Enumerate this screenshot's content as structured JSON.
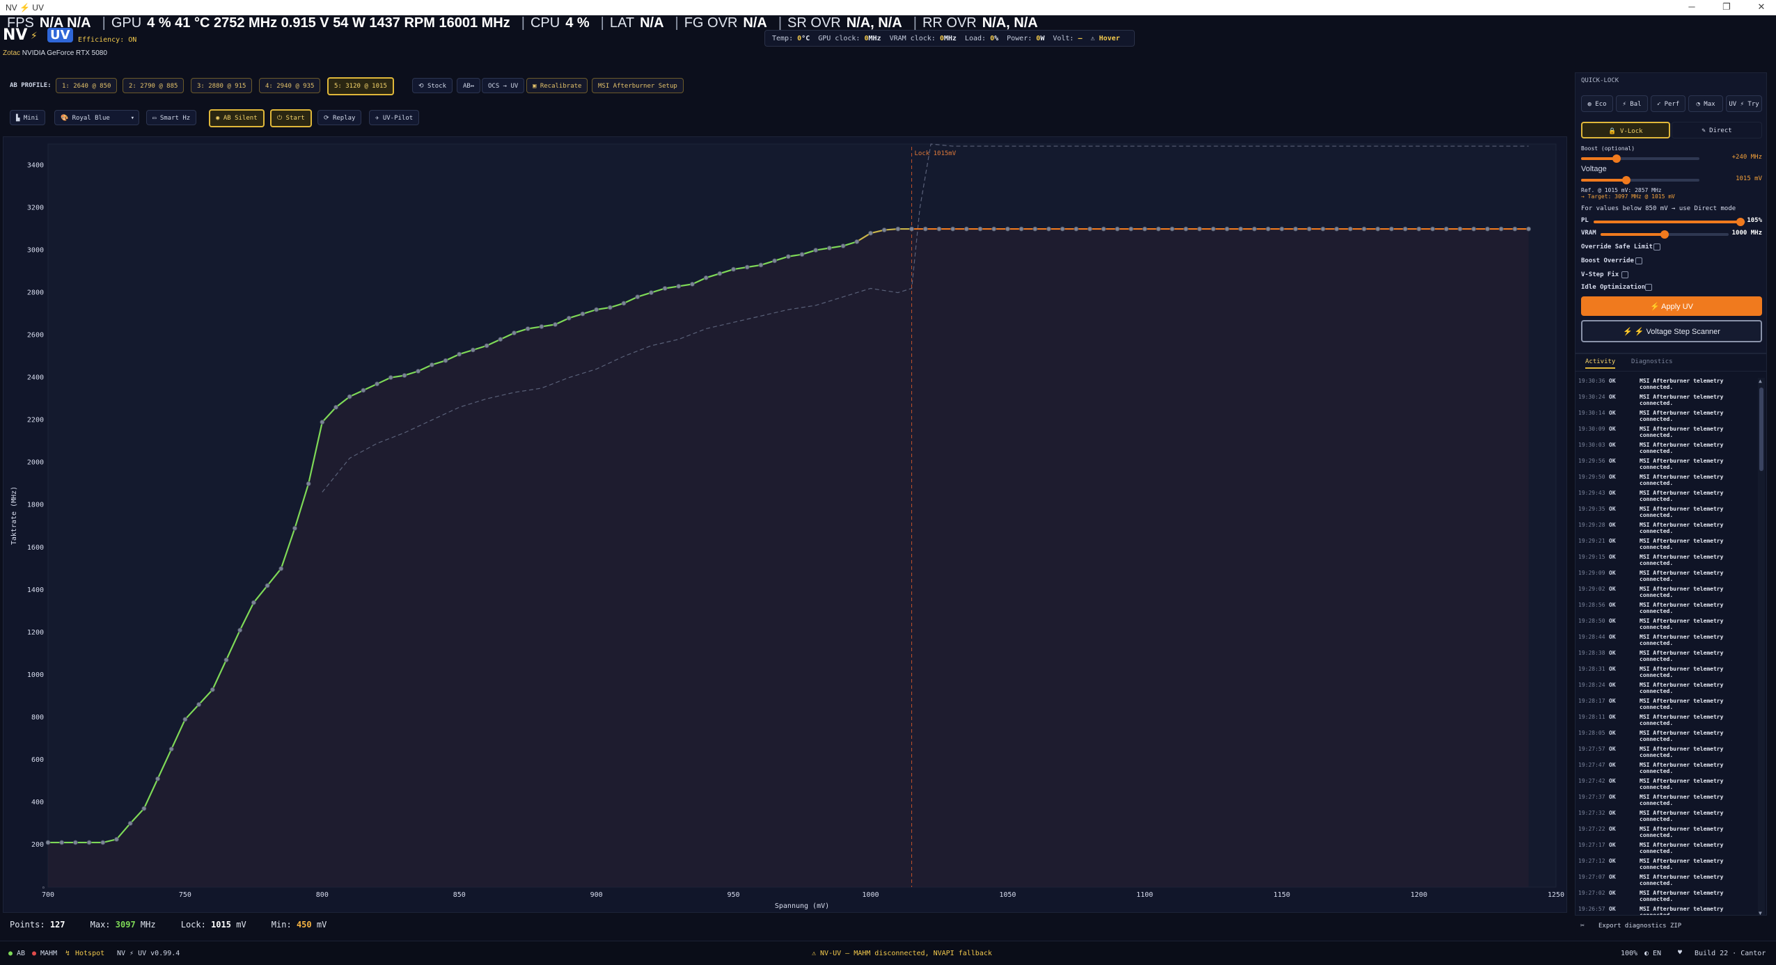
{
  "window": {
    "title": "NV ⚡ UV"
  },
  "osd": [
    {
      "label": "FPS",
      "value": "N/A  N/A"
    },
    {
      "label": "GPU",
      "value": "4 %  41 °C  2752 MHz  0.915 V  54 W  1437 RPM  16001 MHz"
    },
    {
      "label": "CPU",
      "value": "4 %"
    },
    {
      "label": "LAT",
      "value": "N/A"
    },
    {
      "label": "FG OVR",
      "value": "N/A"
    },
    {
      "label": "SR OVR",
      "value": "N/A,  N/A"
    },
    {
      "label": "RR OVR",
      "value": "N/A,  N/A"
    }
  ],
  "logo": {
    "left": "NV",
    "right": "UV"
  },
  "efficiency": "Efficiency: ON",
  "gpu": {
    "brand": "Zotac",
    "model": "NVIDIA GeForce RTX 5080"
  },
  "telemetry": [
    {
      "k": "Temp:",
      "v": "0",
      "u": "°C"
    },
    {
      "k": "GPU clock:",
      "v": "0",
      "u": "MHz"
    },
    {
      "k": "VRAM clock:",
      "v": "0",
      "u": "MHz"
    },
    {
      "k": "Load:",
      "v": "0",
      "u": "%"
    },
    {
      "k": "Power:",
      "v": "0",
      "u": "W"
    },
    {
      "k": "Volt:",
      "v": "—",
      "u": ""
    },
    {
      "k": "⚠",
      "v": "Hover",
      "u": ""
    }
  ],
  "toolbar1": {
    "ab_profile_label": "AB PROFILE:",
    "profiles": [
      "1: 2640 @ 850",
      "2: 2790 @ 885",
      "3: 2880 @ 915",
      "4: 2940 @ 935",
      "5: 3120 @ 1015"
    ],
    "stock": "⟲ Stock",
    "ab": "AB↔",
    "ocs": "OCS → UV",
    "recalibrate": "Recalibrate",
    "msi_setup": "MSI Afterburner Setup"
  },
  "toolbar2": {
    "mini": "Mini",
    "theme": "Royal Blue",
    "smart_hz": "Smart Hz",
    "ab_silent": "AB Silent",
    "start": "Start",
    "replay": "Replay",
    "uv_pilot": "UV-Pilot"
  },
  "chart_data": {
    "type": "line",
    "xlabel": "Spannung (mV)",
    "ylabel": "Taktrate (MHz)",
    "xlim": [
      700,
      1250
    ],
    "ylim": [
      0,
      3500
    ],
    "x_ticks": [
      700,
      750,
      800,
      850,
      900,
      950,
      1000,
      1050,
      1100,
      1150,
      1200,
      1250
    ],
    "y_ticks": [
      200,
      400,
      600,
      800,
      1000,
      1200,
      1400,
      1600,
      1800,
      2000,
      2200,
      2400,
      2600,
      2800,
      3000,
      3200,
      3400
    ],
    "annotation": {
      "text": "Lock 1015mV",
      "x": 1015
    },
    "grid": false,
    "series": [
      {
        "color": "#f07a1e",
        "points": [
          [
            700,
            210
          ],
          [
            705,
            210
          ],
          [
            710,
            210
          ],
          [
            715,
            210
          ],
          [
            720,
            210
          ],
          [
            725,
            225
          ],
          [
            730,
            300
          ],
          [
            735,
            370
          ],
          [
            740,
            510
          ],
          [
            745,
            650
          ],
          [
            750,
            790
          ],
          [
            755,
            860
          ],
          [
            760,
            930
          ],
          [
            765,
            1070
          ],
          [
            770,
            1210
          ],
          [
            775,
            1340
          ],
          [
            780,
            1420
          ],
          [
            785,
            1500
          ],
          [
            790,
            1690
          ],
          [
            795,
            1900
          ],
          [
            800,
            2190
          ],
          [
            805,
            2260
          ],
          [
            810,
            2310
          ],
          [
            815,
            2340
          ],
          [
            820,
            2370
          ],
          [
            825,
            2400
          ],
          [
            830,
            2410
          ],
          [
            835,
            2430
          ],
          [
            840,
            2460
          ],
          [
            845,
            2480
          ],
          [
            850,
            2510
          ],
          [
            855,
            2530
          ],
          [
            860,
            2550
          ],
          [
            865,
            2580
          ],
          [
            870,
            2610
          ],
          [
            875,
            2630
          ],
          [
            880,
            2640
          ],
          [
            885,
            2650
          ],
          [
            890,
            2680
          ],
          [
            895,
            2700
          ],
          [
            900,
            2720
          ],
          [
            905,
            2730
          ],
          [
            910,
            2750
          ],
          [
            915,
            2780
          ],
          [
            920,
            2800
          ],
          [
            925,
            2820
          ],
          [
            930,
            2830
          ],
          [
            935,
            2840
          ],
          [
            940,
            2870
          ],
          [
            945,
            2890
          ],
          [
            950,
            2910
          ],
          [
            955,
            2920
          ],
          [
            960,
            2930
          ],
          [
            965,
            2950
          ],
          [
            970,
            2970
          ],
          [
            975,
            2980
          ],
          [
            980,
            3000
          ],
          [
            985,
            3010
          ],
          [
            990,
            3020
          ],
          [
            995,
            3040
          ],
          [
            1000,
            3080
          ],
          [
            1005,
            3095
          ],
          [
            1010,
            3100
          ],
          [
            1015,
            3100
          ],
          [
            1020,
            3100
          ],
          [
            1025,
            3100
          ],
          [
            1030,
            3100
          ],
          [
            1035,
            3100
          ],
          [
            1040,
            3100
          ],
          [
            1045,
            3100
          ],
          [
            1050,
            3100
          ],
          [
            1055,
            3100
          ],
          [
            1060,
            3100
          ],
          [
            1065,
            3100
          ],
          [
            1070,
            3100
          ],
          [
            1075,
            3100
          ],
          [
            1080,
            3100
          ],
          [
            1085,
            3100
          ],
          [
            1090,
            3100
          ],
          [
            1095,
            3100
          ],
          [
            1100,
            3100
          ],
          [
            1105,
            3100
          ],
          [
            1110,
            3100
          ],
          [
            1115,
            3100
          ],
          [
            1120,
            3100
          ],
          [
            1125,
            3100
          ],
          [
            1130,
            3100
          ],
          [
            1135,
            3100
          ],
          [
            1140,
            3100
          ],
          [
            1145,
            3100
          ],
          [
            1150,
            3100
          ],
          [
            1155,
            3100
          ],
          [
            1160,
            3100
          ],
          [
            1165,
            3100
          ],
          [
            1170,
            3100
          ],
          [
            1175,
            3100
          ],
          [
            1180,
            3100
          ],
          [
            1185,
            3100
          ],
          [
            1190,
            3100
          ],
          [
            1195,
            3100
          ],
          [
            1200,
            3100
          ],
          [
            1205,
            3100
          ],
          [
            1210,
            3100
          ],
          [
            1215,
            3100
          ],
          [
            1220,
            3100
          ],
          [
            1225,
            3100
          ],
          [
            1230,
            3100
          ],
          [
            1235,
            3100
          ],
          [
            1240,
            3100
          ]
        ]
      },
      {
        "color": "#5a6179",
        "points": [
          [
            800,
            1860
          ],
          [
            810,
            2020
          ],
          [
            820,
            2090
          ],
          [
            830,
            2140
          ],
          [
            840,
            2200
          ],
          [
            850,
            2260
          ],
          [
            860,
            2300
          ],
          [
            870,
            2330
          ],
          [
            880,
            2350
          ],
          [
            890,
            2400
          ],
          [
            900,
            2440
          ],
          [
            910,
            2500
          ],
          [
            920,
            2550
          ],
          [
            930,
            2580
          ],
          [
            940,
            2630
          ],
          [
            950,
            2660
          ],
          [
            960,
            2690
          ],
          [
            970,
            2720
          ],
          [
            980,
            2740
          ],
          [
            990,
            2780
          ],
          [
            1000,
            2820
          ],
          [
            1010,
            2800
          ],
          [
            1015,
            2820
          ],
          [
            1018,
            3200
          ],
          [
            1022,
            3500
          ],
          [
            1030,
            3490
          ],
          [
            1100,
            3490
          ],
          [
            1200,
            3490
          ],
          [
            1240,
            3490
          ]
        ]
      }
    ]
  },
  "status": {
    "points_label": "Points:",
    "points": "127",
    "max_label": "Max:",
    "max": "3097",
    "max_unit": "MHz",
    "lock_label": "Lock:",
    "lock": "1015",
    "lock_unit": "mV",
    "min_label": "Min:",
    "min": "450",
    "min_unit": "mV"
  },
  "footer": {
    "ab": "AB",
    "mahm": "MAHM",
    "hotspot": "Hotspot",
    "version": "NV ⚡ UV v0.99.4",
    "warning": "⚠ NV-UV — MAHM disconnected, NVAPI fallback",
    "zoom": "100%",
    "lang": "EN",
    "build": "Build 22 · Cantor"
  },
  "quick_lock": {
    "title": "QUICK-LOCK",
    "presets": [
      "Eco",
      "Bal",
      "Perf",
      "Max",
      "UV ⚡ Try"
    ],
    "v_lock": "V-Lock",
    "direct": "Direct",
    "boost_label": "Boost (optional)",
    "boost_value": "+240 MHz",
    "boost_level": 0.3,
    "voltage_label": "Voltage",
    "voltage_value": "1015 mV",
    "voltage_level": 0.38,
    "ref_line": "Ref. @ 1015 mV: 2857 MHz",
    "target_line": "→ Target: 3097 MHz @ 1015 mV",
    "below_note": "For values below 850 mV → use Direct mode",
    "pl_label": "PL",
    "pl_value": "105%",
    "pl_level": 0.97,
    "vram_label": "VRAM",
    "vram_value": "1000 MHz",
    "vram_level": 0.5,
    "options": [
      "Override Safe Limit",
      "Boost Override",
      "V-Step Fix",
      "Idle Optimization"
    ],
    "apply": "Apply UV",
    "scanner": "Voltage Step Scanner",
    "accent": "#f07a1e"
  },
  "activity": {
    "tabs": [
      "Activity",
      "Diagnostics"
    ],
    "entries": [
      {
        "t": "19:30:36",
        "s": "OK",
        "m": "MSI Afterburner telemetry connected."
      },
      {
        "t": "19:30:24",
        "s": "OK",
        "m": "MSI Afterburner telemetry connected."
      },
      {
        "t": "19:30:14",
        "s": "OK",
        "m": "MSI Afterburner telemetry connected."
      },
      {
        "t": "19:30:09",
        "s": "OK",
        "m": "MSI Afterburner telemetry connected."
      },
      {
        "t": "19:30:03",
        "s": "OK",
        "m": "MSI Afterburner telemetry connected."
      },
      {
        "t": "19:29:56",
        "s": "OK",
        "m": "MSI Afterburner telemetry connected."
      },
      {
        "t": "19:29:50",
        "s": "OK",
        "m": "MSI Afterburner telemetry connected."
      },
      {
        "t": "19:29:43",
        "s": "OK",
        "m": "MSI Afterburner telemetry connected."
      },
      {
        "t": "19:29:35",
        "s": "OK",
        "m": "MSI Afterburner telemetry connected."
      },
      {
        "t": "19:29:28",
        "s": "OK",
        "m": "MSI Afterburner telemetry connected."
      },
      {
        "t": "19:29:21",
        "s": "OK",
        "m": "MSI Afterburner telemetry connected."
      },
      {
        "t": "19:29:15",
        "s": "OK",
        "m": "MSI Afterburner telemetry connected."
      },
      {
        "t": "19:29:09",
        "s": "OK",
        "m": "MSI Afterburner telemetry connected."
      },
      {
        "t": "19:29:02",
        "s": "OK",
        "m": "MSI Afterburner telemetry connected."
      },
      {
        "t": "19:28:56",
        "s": "OK",
        "m": "MSI Afterburner telemetry connected."
      },
      {
        "t": "19:28:50",
        "s": "OK",
        "m": "MSI Afterburner telemetry connected."
      },
      {
        "t": "19:28:44",
        "s": "OK",
        "m": "MSI Afterburner telemetry connected."
      },
      {
        "t": "19:28:38",
        "s": "OK",
        "m": "MSI Afterburner telemetry connected."
      },
      {
        "t": "19:28:31",
        "s": "OK",
        "m": "MSI Afterburner telemetry connected."
      },
      {
        "t": "19:28:24",
        "s": "OK",
        "m": "MSI Afterburner telemetry connected."
      },
      {
        "t": "19:28:17",
        "s": "OK",
        "m": "MSI Afterburner telemetry connected."
      },
      {
        "t": "19:28:11",
        "s": "OK",
        "m": "MSI Afterburner telemetry connected."
      },
      {
        "t": "19:28:05",
        "s": "OK",
        "m": "MSI Afterburner telemetry connected."
      },
      {
        "t": "19:27:57",
        "s": "OK",
        "m": "MSI Afterburner telemetry connected."
      },
      {
        "t": "19:27:47",
        "s": "OK",
        "m": "MSI Afterburner telemetry connected."
      },
      {
        "t": "19:27:42",
        "s": "OK",
        "m": "MSI Afterburner telemetry connected."
      },
      {
        "t": "19:27:37",
        "s": "OK",
        "m": "MSI Afterburner telemetry connected."
      },
      {
        "t": "19:27:32",
        "s": "OK",
        "m": "MSI Afterburner telemetry connected."
      },
      {
        "t": "19:27:22",
        "s": "OK",
        "m": "MSI Afterburner telemetry connected."
      },
      {
        "t": "19:27:17",
        "s": "OK",
        "m": "MSI Afterburner telemetry connected."
      },
      {
        "t": "19:27:12",
        "s": "OK",
        "m": "MSI Afterburner telemetry connected."
      },
      {
        "t": "19:27:07",
        "s": "OK",
        "m": "MSI Afterburner telemetry connected."
      },
      {
        "t": "19:27:02",
        "s": "OK",
        "m": "MSI Afterburner telemetry connected."
      },
      {
        "t": "19:26:57",
        "s": "OK",
        "m": "MSI Afterburner telemetry connected."
      }
    ],
    "export": "Export diagnostics ZIP"
  }
}
